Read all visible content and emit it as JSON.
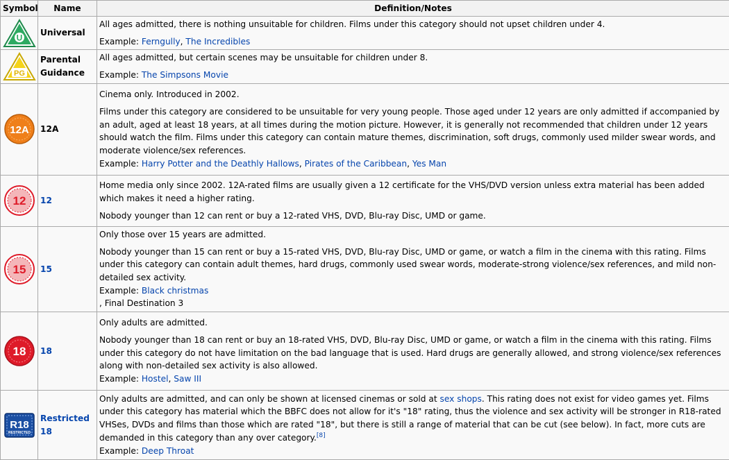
{
  "headers": {
    "symbol": "Symbol",
    "name": "Name",
    "definition": "Definition/Notes"
  },
  "rows": [
    {
      "name": "Universal",
      "symbol": {
        "label": "U",
        "shape": "triangle",
        "color": "#2eaa62"
      },
      "p1": "All ages admitted, there is nothing unsuitable for children. Films under this category should not upset children under 4.",
      "example_label": "Example: ",
      "links": [
        "Ferngully",
        "The Incredibles"
      ]
    },
    {
      "name": "Parental Guidance",
      "symbol": {
        "label": "PG",
        "shape": "triangle",
        "color": "#f5d41a"
      },
      "p1": "All ages admitted, but certain scenes may be unsuitable for children under 8.",
      "example_label": "Example: ",
      "links": [
        "The Simpsons Movie"
      ]
    },
    {
      "name": "12A",
      "symbol": {
        "label": "12A",
        "shape": "circle",
        "color": "#ef7f1a"
      },
      "p1": "Cinema only. Introduced in 2002.",
      "p2": "Films under this category are considered to be unsuitable for very young people. Those aged under 12 years are only admitted if accompanied by an adult, aged at least 18 years, at all times during the motion picture. However, it is generally not recommended that children under 12 years should watch the film. Films under this category can contain mature themes, discrimination, soft drugs, commonly used milder swear words, and moderate violence/sex references.",
      "example_label": "Example: ",
      "links": [
        "Harry Potter and the Deathly Hallows",
        "Pirates of the Caribbean",
        "Yes Man"
      ]
    },
    {
      "name": "12",
      "symbol": {
        "label": "12",
        "shape": "circle",
        "color": "#de1b29"
      },
      "p1": "Home media only since 2002. 12A-rated films are usually given a 12 certificate for the VHS/DVD version unless extra material has been added which makes it need a higher rating.",
      "p2": "Nobody younger than 12 can rent or buy a 12-rated VHS, DVD, Blu-ray Disc, UMD or game."
    },
    {
      "name": "15",
      "symbol": {
        "label": "15",
        "shape": "circle",
        "color": "#de1b29"
      },
      "p1": "Only those over 15 years are admitted.",
      "p2": "Nobody younger than 15 can rent or buy a 15-rated VHS, DVD, Blu-ray Disc, UMD or game, or watch a film in the cinema with this rating. Films under this category can contain adult themes, hard drugs, commonly used swear words, moderate-strong violence/sex references, and mild non-detailed sex activity.",
      "example_label": "Example: ",
      "links": [
        "Black christmas"
      ],
      "trailing": ", Final Destination 3"
    },
    {
      "name": "18",
      "symbol": {
        "label": "18",
        "shape": "circle",
        "color": "#de1b29"
      },
      "p1": "Only adults are admitted.",
      "p2": "Nobody younger than 18 can rent or buy an 18-rated VHS, DVD, Blu-ray Disc, UMD or game, or watch a film in the cinema with this rating. Films under this category do not have limitation on the bad language that is used. Hard drugs are generally allowed, and strong violence/sex references along with non-detailed sex activity is also allowed.",
      "example_label": "Example: ",
      "links": [
        "Hostel",
        "Saw III"
      ]
    },
    {
      "name": "Restricted 18",
      "symbol": {
        "label": "R18",
        "sublabel": "RESTRICTED",
        "shape": "square",
        "color": "#1b4fa3"
      },
      "p1_before": "Only adults are admitted, and can only be shown at licensed cinemas or sold at ",
      "p1_link": "sex shops",
      "p1_after": ". This rating does not exist for video games yet. Films under this category has material which the BBFC does not allow for it's \"18\" rating, thus the violence and sex activity will be stronger in R18-rated VHSes, DVDs and films than those which are rated \"18\", but there is still a range of material that can be cut (see below). In fact, more cuts are demanded in this category than any over category.",
      "ref": "[8]",
      "example_label": "Example: ",
      "links": [
        "Deep Throat"
      ]
    }
  ]
}
